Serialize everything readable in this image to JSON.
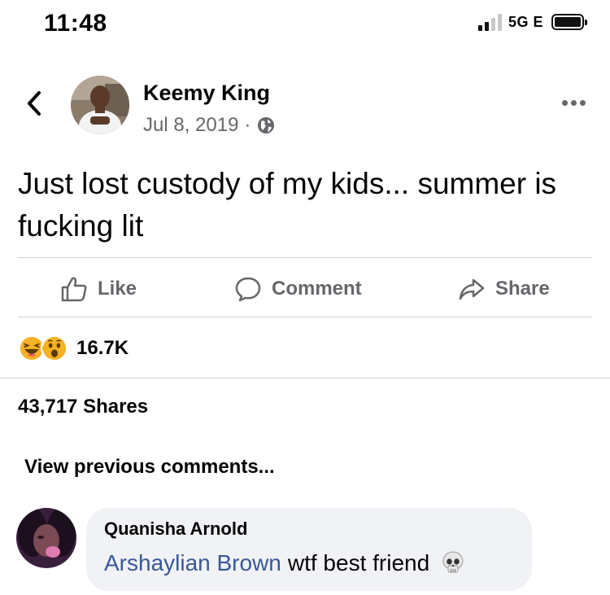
{
  "status_bar": {
    "time": "11:48",
    "network": "5G E"
  },
  "post": {
    "author": "Keemy King",
    "date": "Jul 8, 2019",
    "separator": "·",
    "text": "Just lost custody of my kids... summer is fucking lit",
    "actions": {
      "like": "Like",
      "comment": "Comment",
      "share": "Share"
    },
    "reactions": {
      "emojis": [
        "laughing-emoji",
        "wow-emoji"
      ],
      "count": "16.7K"
    },
    "shares": "43,717 Shares",
    "view_previous": "View previous comments..."
  },
  "comment": {
    "author": "Quanisha Arnold",
    "mention": "Arshaylian Brown",
    "text": "wtf best friend",
    "emoji": "skull-emoji"
  },
  "colors": {
    "meta_gray": "#65676b",
    "mention_blue": "#385898",
    "bubble_bg": "#f0f2f5",
    "divider": "#ced0d4",
    "reaction_yellow": "#f7b125"
  }
}
